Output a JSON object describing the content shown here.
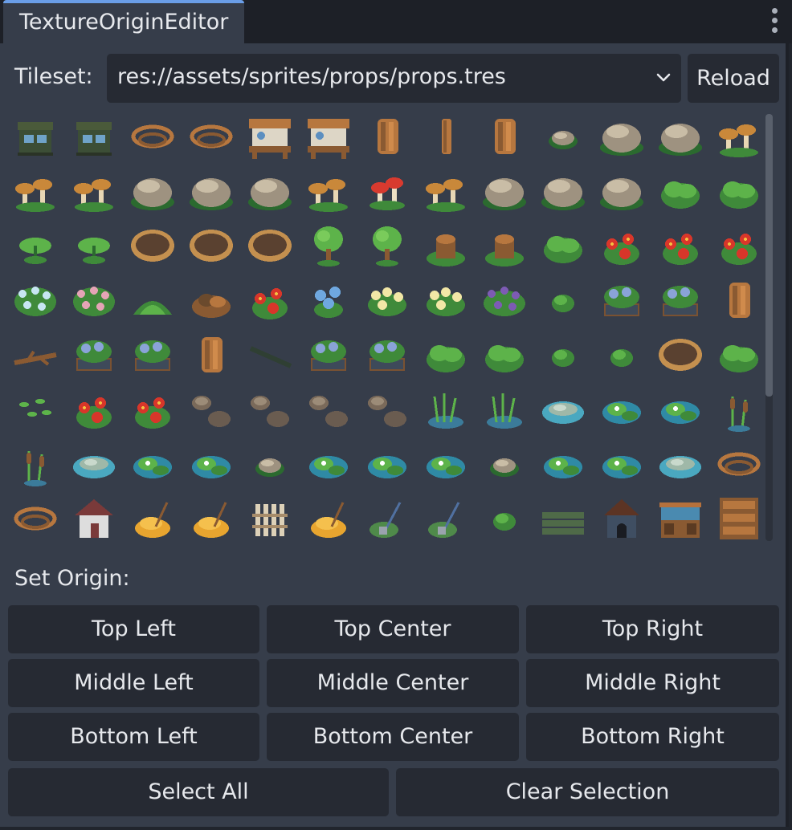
{
  "tab": {
    "title": "TextureOriginEditor"
  },
  "tileset": {
    "label": "Tileset:",
    "value": "res://assets/sprites/props/props.tres",
    "reload_label": "Reload"
  },
  "origin": {
    "label": "Set Origin:",
    "buttons": [
      "Top Left",
      "Top Center",
      "Top Right",
      "Middle Left",
      "Middle Center",
      "Middle Right",
      "Bottom Left",
      "Bottom Center",
      "Bottom Right"
    ]
  },
  "actions": {
    "select_all": "Select All",
    "clear_selection": "Clear Selection"
  },
  "colors": {
    "panel": "#363d4a",
    "button": "#262a33",
    "accent": "#6a9ee8",
    "text": "#e6e8ec"
  },
  "tiles": [
    "hut-icon",
    "hut-icon",
    "rope-icon",
    "rope-icon",
    "workbench-icon",
    "workbench-icon",
    "log-icon",
    "post-icon",
    "log-icon",
    "rock-small-icon",
    "rock-icon",
    "rock-icon",
    "mushroom-icon",
    "mushroom-icon",
    "mushroom-icon",
    "rock-icon",
    "rock-icon",
    "rock-icon",
    "mushroom-icon",
    "mushroom-red-icon",
    "mushroom-icon",
    "rock-icon",
    "rock-icon",
    "rock-icon",
    "bush-icon",
    "bush-icon",
    "plant-icon",
    "plant-icon",
    "basket-icon",
    "basket-icon",
    "basket-icon",
    "tree-small-icon",
    "tree-small-icon",
    "stump-icon",
    "stump-icon",
    "bush-icon",
    "flower-red-icon",
    "flower-red-icon",
    "flower-red-icon",
    "flower-white-icon",
    "flower-pink-icon",
    "grass-mound-icon",
    "dirt-pile-icon",
    "flower-red-icon",
    "flower-blue-icon",
    "flower-yellow-icon",
    "flower-yellow-icon",
    "flower-purple-icon",
    "bush-small-icon",
    "planter-icon",
    "planter-icon",
    "log-icon",
    "branch-icon",
    "planter-icon",
    "planter-icon",
    "log-icon",
    "stick-icon",
    "planter-icon",
    "planter-icon",
    "bush-icon",
    "bush-icon",
    "bush-small-icon",
    "bush-small-icon",
    "basket-icon",
    "bush-icon",
    "grass-icon",
    "flower-red-icon",
    "flower-red-icon",
    "stones-icon",
    "stones-icon",
    "stones-icon",
    "stones-icon",
    "reeds-icon",
    "reeds-icon",
    "pond-icon",
    "lily-icon",
    "lily-icon",
    "cattail-icon",
    "cattail-icon",
    "pond-icon",
    "lily-icon",
    "lily-icon",
    "rock-small-icon",
    "lily-icon",
    "lily-icon",
    "lily-icon",
    "rock-small-icon",
    "lily-icon",
    "lily-icon",
    "pond-icon",
    "rope-icon",
    "rope-icon",
    "house-icon",
    "haystack-icon",
    "haystack-icon",
    "fence-icon",
    "haystack-icon",
    "shovel-icon",
    "shovel-icon",
    "bush-small-icon",
    "plank-icon",
    "doghouse-icon",
    "stall-icon",
    "crate-icon"
  ]
}
